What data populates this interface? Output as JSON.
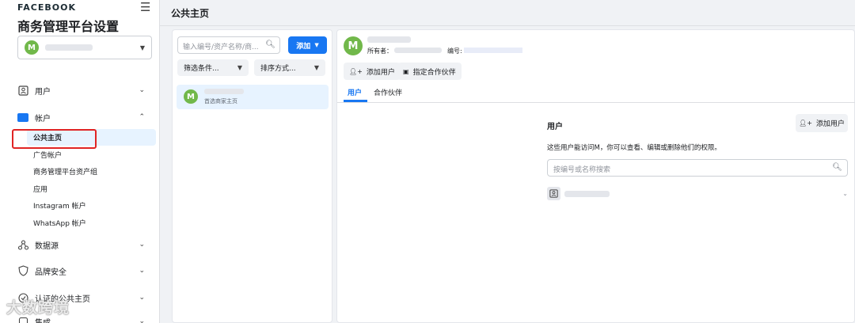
{
  "sidebar": {
    "brand": "FACEBOOK",
    "title": "商务管理平台设置",
    "account_avatar": "M",
    "nav": [
      {
        "label": "用户",
        "icon": "user-badge-icon",
        "expanded": false
      },
      {
        "label": "帐户",
        "icon": "briefcase-icon",
        "expanded": true
      },
      {
        "label": "数据源",
        "icon": "data-sources-icon",
        "expanded": false
      },
      {
        "label": "品牌安全",
        "icon": "shield-icon",
        "expanded": false
      },
      {
        "label": "认证的公共主页",
        "icon": "verified-page-icon",
        "expanded": false
      },
      {
        "label": "集成",
        "icon": "integrations-icon",
        "expanded": false
      }
    ],
    "sub_items": [
      "公共主页",
      "广告帐户",
      "商务管理平台资产组",
      "应用",
      "Instagram 帐户",
      "WhatsApp 帐户"
    ]
  },
  "header": {
    "title": "公共主页"
  },
  "list": {
    "search_placeholder": "输入编号/资产名称/商...",
    "add_label": "添加",
    "filter_label": "筛选条件...",
    "sort_label": "排序方式...",
    "item": {
      "avatar": "M",
      "subtitle": "首选商家主页"
    }
  },
  "detail": {
    "avatar": "M",
    "owner_label": "所有者：",
    "id_label": "编号:",
    "add_user_label": "添加用户",
    "assign_partner_label": "指定合作伙伴",
    "tabs": [
      "用户",
      "合作伙伴"
    ],
    "users_title": "用户",
    "users_add_label": "添加用户",
    "users_desc": "这些用户能访问M，你可以查看、编辑或删除他们的权限。",
    "users_search_placeholder": "按编号或名称搜索"
  },
  "watermark": "大数跨境",
  "colors": {
    "accent": "#1877f2",
    "avatar": "#71b84a",
    "highlight": "#e02424"
  }
}
